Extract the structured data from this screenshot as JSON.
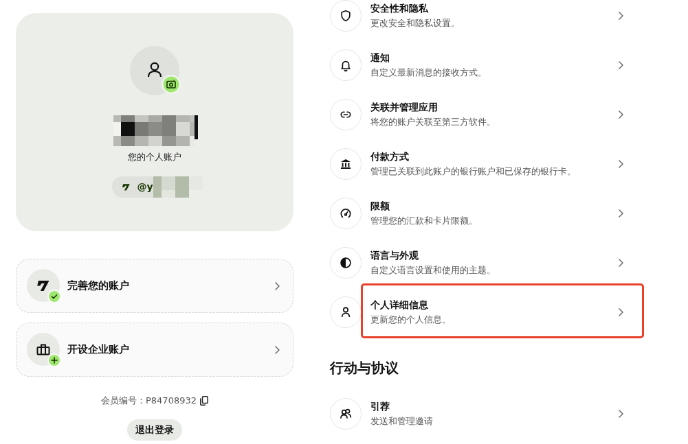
{
  "profile": {
    "account_type": "您的个人账户",
    "handle": "@y"
  },
  "account_actions": [
    {
      "kind": "verify",
      "label": "完善您的账户"
    },
    {
      "kind": "business",
      "label": "开设企业账户"
    }
  ],
  "member_id": "会员编号：P84708932",
  "logout_button": "退出登录",
  "settings_groups": [
    {
      "items": [
        {
          "kind": "security",
          "title": "安全性和隐私",
          "description": "更改安全和隐私设置。",
          "highlighted": false
        },
        {
          "kind": "notifications",
          "title": "通知",
          "description": "自定义最新消息的接收方式。",
          "highlighted": false
        },
        {
          "kind": "apps",
          "title": "关联并管理应用",
          "description": "将您的账户关联至第三方软件。",
          "highlighted": false
        },
        {
          "kind": "payment",
          "title": "付款方式",
          "description": "管理已关联到此账户的银行账户和已保存的银行卡。",
          "highlighted": false
        },
        {
          "kind": "limits",
          "title": "限额",
          "description": "管理您的汇款和卡片限额。",
          "highlighted": false
        },
        {
          "kind": "appearance",
          "title": "语言与外观",
          "description": "自定义语言设置和使用的主题。",
          "highlighted": false
        },
        {
          "kind": "personal",
          "title": "个人详细信息",
          "description": "更新您的个人信息。",
          "highlighted": true
        }
      ]
    },
    {
      "heading": "行动与协议",
      "items": [
        {
          "kind": "referral",
          "title": "引荐",
          "description": "发送和管理邀请",
          "highlighted": false
        }
      ]
    }
  ]
}
